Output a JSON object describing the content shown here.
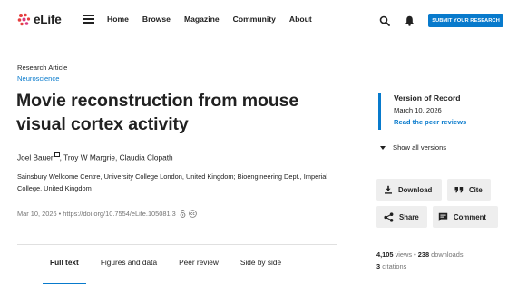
{
  "header": {
    "logo_text": "eLife",
    "nav": [
      "Home",
      "Browse",
      "Magazine",
      "Community",
      "About"
    ],
    "submit_label": "SUBMIT YOUR RESEARCH",
    "brand_color": "#087acc"
  },
  "article": {
    "type": "Research Article",
    "subject": "Neuroscience",
    "title": "Movie reconstruction from mouse visual cortex activity",
    "author_first": "Joel Bauer",
    "authors_rest": ", Troy W Margrie, Claudia Clopath",
    "affiliations": "Sainsbury Wellcome Centre, University College London, United Kingdom; Bioengineering Dept., Imperial College, United Kingdom",
    "date": "Mar 10, 2026",
    "doi": "https://doi.org/10.7554/eLife.105081.3"
  },
  "tabs": [
    "Full text",
    "Figures and data",
    "Peer review",
    "Side by side"
  ],
  "sidebar": {
    "vor_title": "Version of Record",
    "vor_date": "March 10, 2026",
    "vor_link": "Read the peer reviews",
    "versions_label": "Show all versions",
    "download_label": "Download",
    "cite_label": "Cite",
    "share_label": "Share",
    "comment_label": "Comment",
    "views": "4,105",
    "views_label": "views",
    "downloads": "238",
    "downloads_label": "downloads",
    "citations": "3",
    "citations_label": "citations"
  },
  "icons": [
    "menu-icon",
    "search-icon",
    "bell-icon",
    "email-icon",
    "open-access-icon",
    "creative-commons-icon",
    "download-icon",
    "quote-icon",
    "share-icon",
    "comment-icon",
    "triangle-down-icon"
  ]
}
